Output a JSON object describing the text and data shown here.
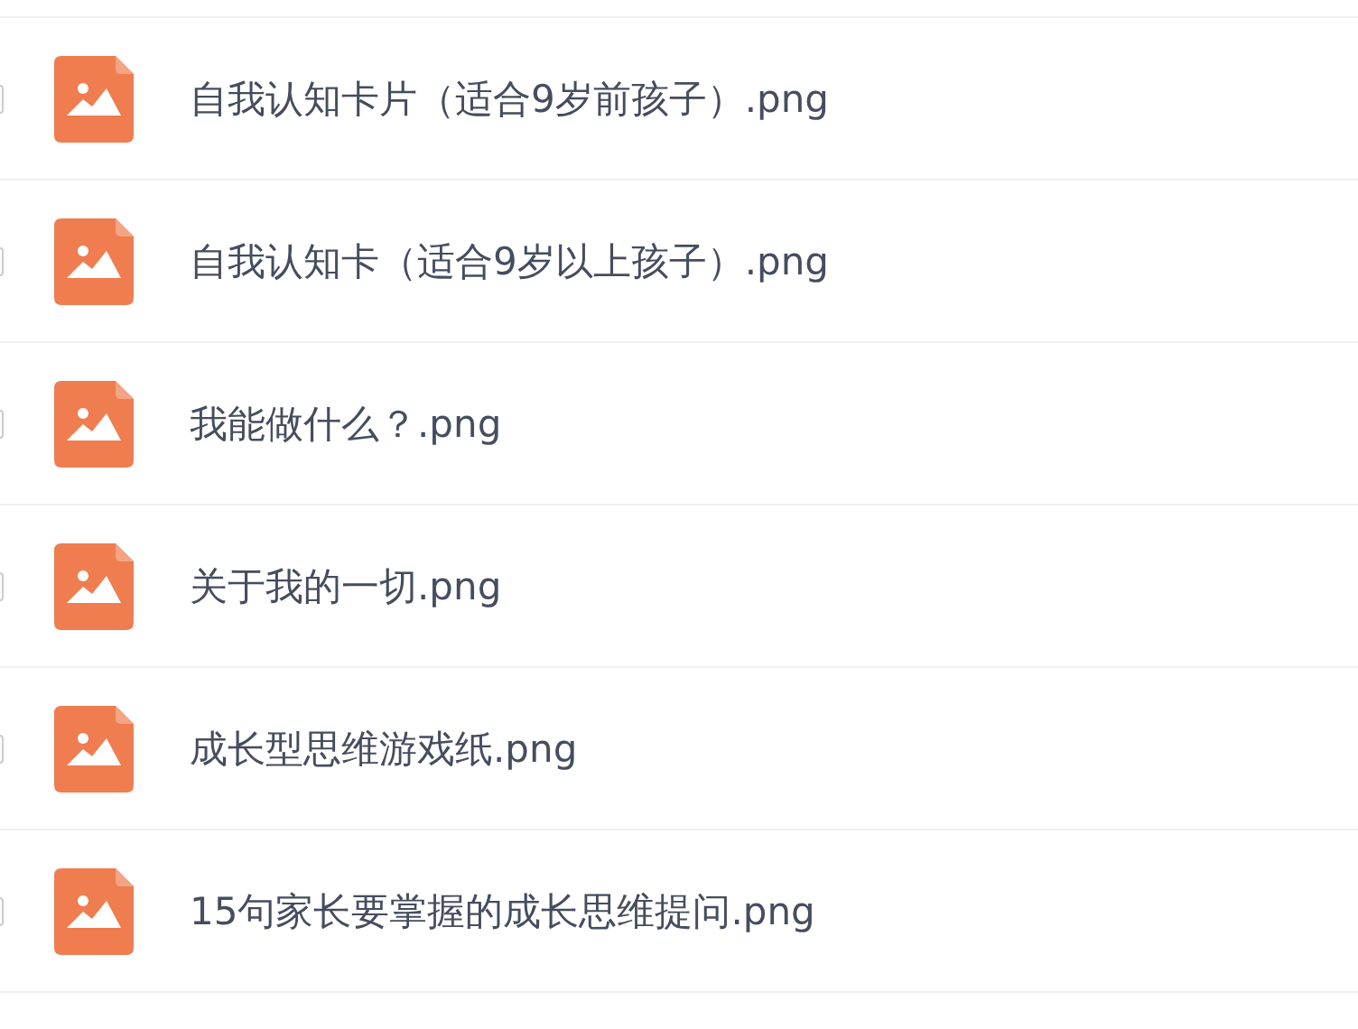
{
  "files": [
    {
      "name": "自我认知卡片（适合9岁前孩子）.png",
      "checked": false
    },
    {
      "name": "自我认知卡（适合9岁以上孩子）.png",
      "checked": false
    },
    {
      "name": "我能做什么？.png",
      "checked": false
    },
    {
      "name": "关于我的一切.png",
      "checked": false
    },
    {
      "name": "成长型思维游戏纸.png",
      "checked": false
    },
    {
      "name": "15句家长要掌握的成长思维提问.png",
      "checked": false
    }
  ]
}
